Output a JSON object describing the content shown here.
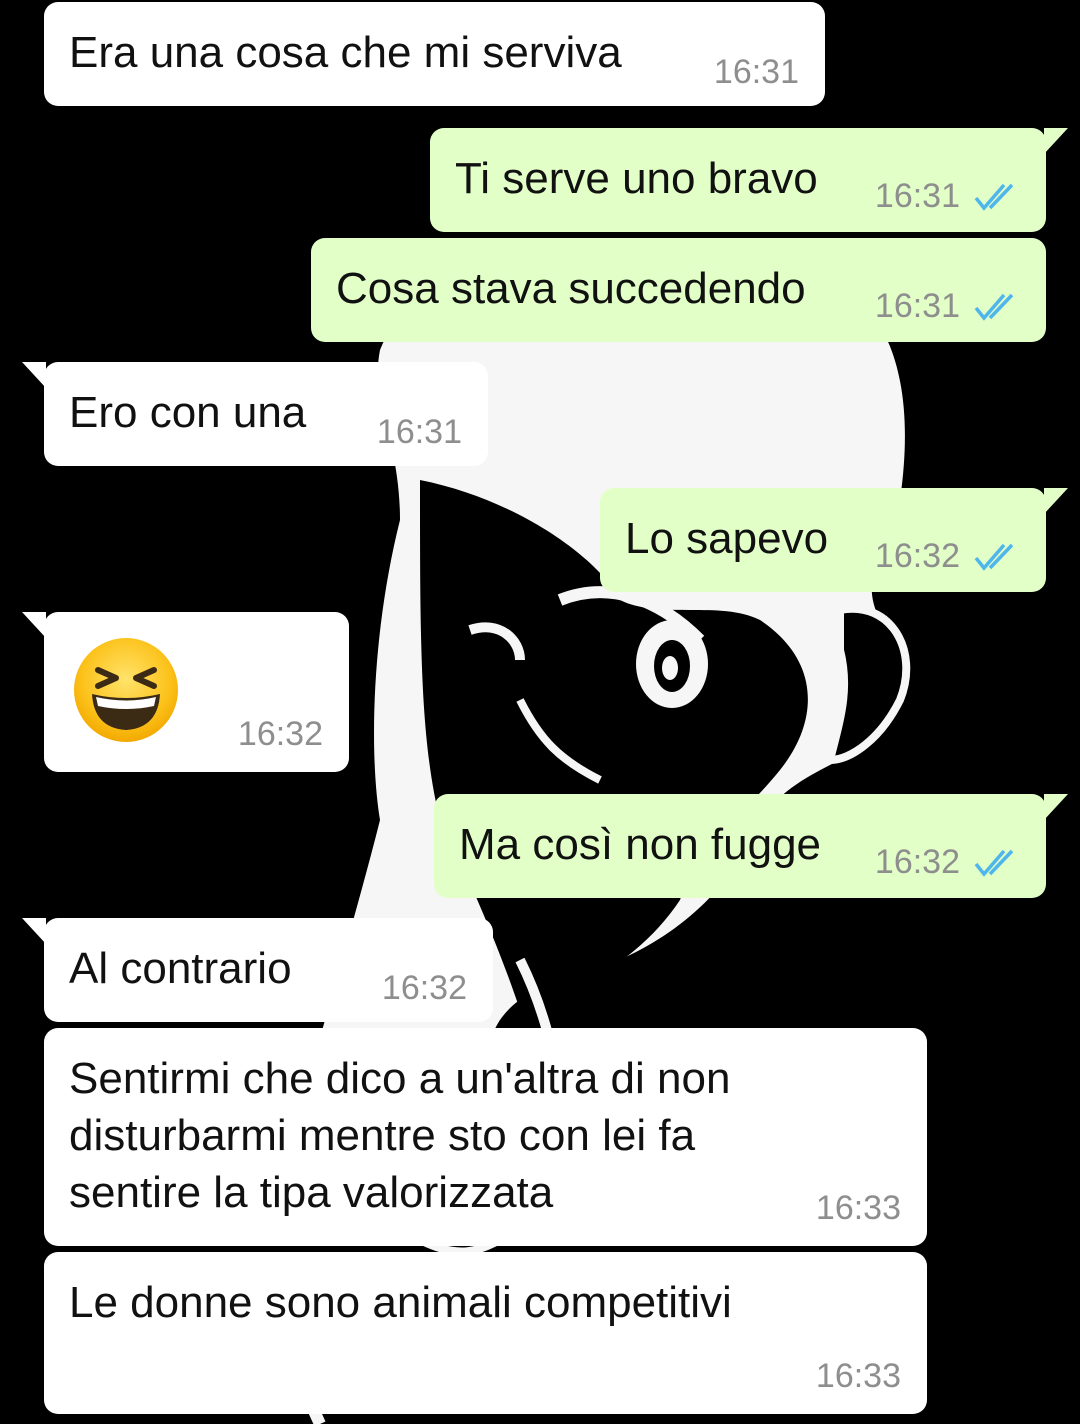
{
  "chat": {
    "messages": [
      {
        "id": "m1",
        "direction": "in",
        "text": "Era una cosa che mi serviva",
        "time": "16:31"
      },
      {
        "id": "m2",
        "direction": "out",
        "text": "Ti serve uno bravo",
        "time": "16:31",
        "status": "read"
      },
      {
        "id": "m3",
        "direction": "out",
        "text": "Cosa stava succedendo",
        "time": "16:31",
        "status": "read"
      },
      {
        "id": "m4",
        "direction": "in",
        "text": "Ero con una",
        "time": "16:31"
      },
      {
        "id": "m5",
        "direction": "out",
        "text": "Lo sapevo",
        "time": "16:32",
        "status": "read"
      },
      {
        "id": "m6",
        "direction": "in",
        "emoji": "grinning-squinting-face",
        "time": "16:32"
      },
      {
        "id": "m7",
        "direction": "out",
        "text": "Ma così non fugge",
        "time": "16:32",
        "status": "read"
      },
      {
        "id": "m8",
        "direction": "in",
        "text": "Al contrario",
        "time": "16:32"
      },
      {
        "id": "m9",
        "direction": "in",
        "text": "Sentirmi che dico a un'altra di non\ndisturbarmi mentre sto con lei fa\nsentire la tipa valorizzata",
        "time": "16:33"
      },
      {
        "id": "m10",
        "direction": "in",
        "text": "Le donne sono animali competitivi",
        "time": "16:33"
      }
    ]
  },
  "colors": {
    "background": "#000000",
    "incoming_bubble": "#ffffff",
    "outgoing_bubble": "#e1ffc7",
    "timestamp": "#8e8e8e",
    "read_ticks": "#4fb6ec"
  },
  "icons": {
    "read_receipt": "double-check-icon",
    "emoji": "grinning-squinting-face-emoji"
  }
}
